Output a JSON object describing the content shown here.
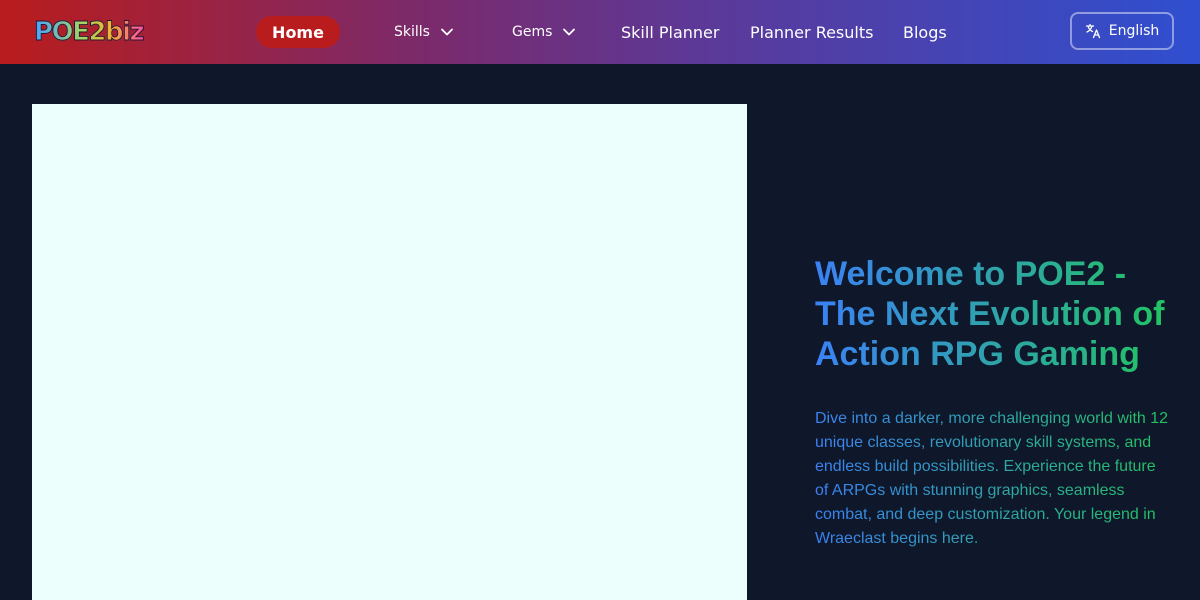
{
  "brand": {
    "logo_text": "POE2biz"
  },
  "nav": {
    "home": "Home",
    "skills": "Skills",
    "gems": "Gems",
    "skill_planner": "Skill Planner",
    "planner_results": "Planner Results",
    "blogs": "Blogs",
    "active": "Home"
  },
  "language": {
    "label": "English",
    "icon": "translate-icon"
  },
  "hero": {
    "title": "Welcome to POE2 - The Next Evolution of Action RPG Gaming",
    "description": "Dive into a darker, more challenging world with 12 unique classes, revolutionary skill systems, and endless build possibilities. Experience the future of ARPGs with stunning graphics, seamless combat, and deep customization. Your legend in Wraeclast begins here."
  },
  "colors": {
    "nav_gradient_start": "#b91c1c",
    "nav_gradient_end": "#2f4fd0",
    "active_pill": "#b91c1c",
    "page_background": "#0f172a",
    "hero_gradient_start": "#3b82f6",
    "hero_gradient_end": "#22c55e",
    "image_placeholder": "#ecfffc"
  }
}
